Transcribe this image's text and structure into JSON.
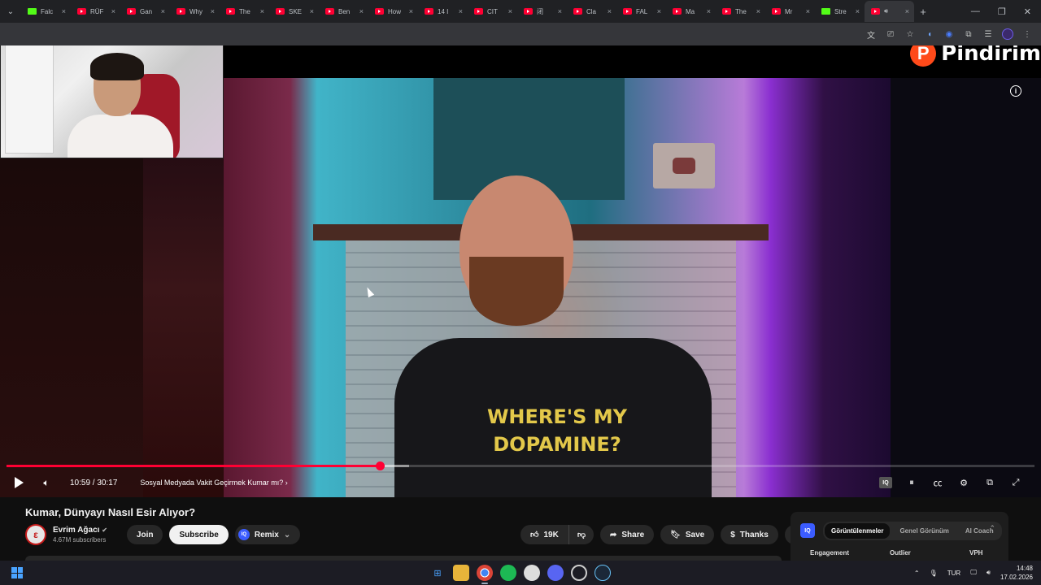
{
  "browser": {
    "tabs": [
      {
        "label": "Falc",
        "favicon": "kick"
      },
      {
        "label": "RÜF",
        "favicon": "youtube"
      },
      {
        "label": "Gan",
        "favicon": "youtube"
      },
      {
        "label": "Why",
        "favicon": "youtube"
      },
      {
        "label": "The",
        "favicon": "youtube"
      },
      {
        "label": "SKE",
        "favicon": "youtube"
      },
      {
        "label": "Ben",
        "favicon": "youtube"
      },
      {
        "label": "How",
        "favicon": "youtube"
      },
      {
        "label": "14 I",
        "favicon": "youtube"
      },
      {
        "label": "CIT",
        "favicon": "youtube"
      },
      {
        "label": "闭",
        "favicon": "youtube"
      },
      {
        "label": "Cla",
        "favicon": "youtube"
      },
      {
        "label": "FAL",
        "favicon": "youtube"
      },
      {
        "label": "Ma",
        "favicon": "youtube"
      },
      {
        "label": "The",
        "favicon": "youtube"
      },
      {
        "label": "Mr",
        "favicon": "youtube"
      },
      {
        "label": "Stre",
        "favicon": "kick"
      },
      {
        "label": "",
        "favicon": "youtube",
        "active": true
      }
    ],
    "tab_close_glyph": "×",
    "new_tab_glyph": "+"
  },
  "player": {
    "brand_name": "Pindirim",
    "brand_badge": "P",
    "time_display": "10:59 / 30:17",
    "chapter_title": "Sosyal Medyada Vakit Geçirmek Kumar mı?",
    "shirt_text_line1": "WHERE'S MY",
    "shirt_text_line2": "DOPAMINE?",
    "progress_played_fraction": 0.363,
    "progress_loaded_fraction": 0.392,
    "info_glyph": "i"
  },
  "video": {
    "title": "Kumar, Dünyayı Nasıl Esir Alıyor?",
    "channel_name": "Evrim Ağacı",
    "subscribers": "4.67M subscribers",
    "join_label": "Join",
    "subscribe_label": "Subscribe",
    "remix_label": "Remix",
    "like_count": "19K",
    "share_label": "Share",
    "save_label": "Save",
    "thanks_label": "Thanks"
  },
  "iq_panel": {
    "badge": "IQ",
    "tabs": [
      "Görüntülenmeler",
      "Genel Görünüm",
      "AI Coach"
    ],
    "columns": [
      "Engagement",
      "Outlier",
      "VPH"
    ]
  },
  "taskbar": {
    "language": "TUR",
    "time": "14:48",
    "date": "17.02.2026"
  },
  "colors": {
    "accent_red": "#ff0033",
    "kick_green": "#53fc18",
    "iq_blue": "#3b5cff"
  }
}
